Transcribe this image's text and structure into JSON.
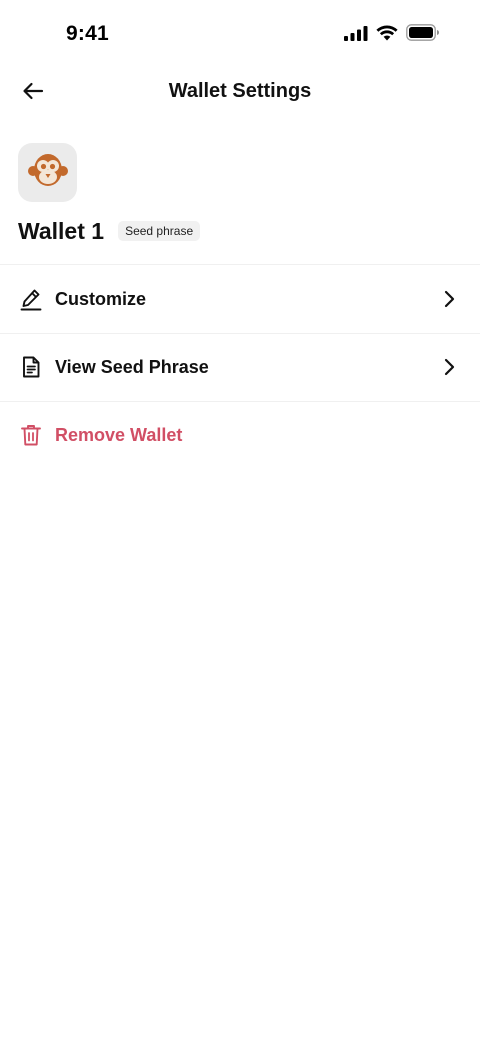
{
  "status_bar": {
    "time": "9:41",
    "icons": [
      "cellular-signal-icon",
      "wifi-icon",
      "battery-icon"
    ]
  },
  "header": {
    "title": "Wallet Settings",
    "back_icon": "arrow-left-icon"
  },
  "wallet": {
    "name": "Wallet 1",
    "badge": "Seed phrase",
    "avatar_icon": "monkey-avatar-icon"
  },
  "menu": {
    "items": [
      {
        "label": "Customize",
        "icon": "pencil-icon",
        "has_chevron": true
      },
      {
        "label": "View Seed Phrase",
        "icon": "document-icon",
        "has_chevron": true
      },
      {
        "label": "Remove Wallet",
        "icon": "trash-icon",
        "has_chevron": false,
        "color": "#d14f65"
      }
    ]
  },
  "colors": {
    "background": "#ffffff",
    "text": "#111111",
    "danger": "#d14f65",
    "avatar_bg": "#ebebeb",
    "avatar_accent": "#c2692c",
    "badge_bg": "#f1f1f1"
  }
}
